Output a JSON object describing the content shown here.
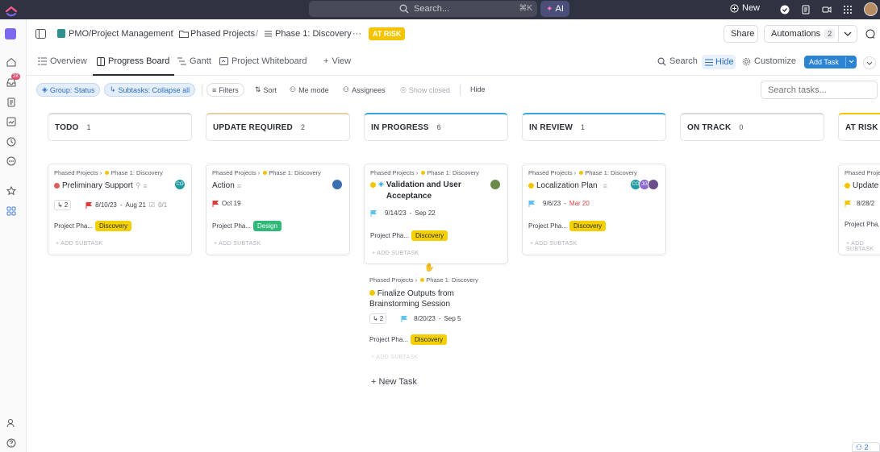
{
  "topbar": {
    "search_placeholder": "Search...",
    "search_shortcut": "⌘K",
    "ai_label": "AI",
    "new_label": "New"
  },
  "breadcrumb": {
    "space": "PMO/Project Management",
    "folder": "Phased Projects",
    "list": "Phase 1: Discovery",
    "more": "···",
    "status_badge": "AT RISK"
  },
  "header_actions": {
    "share": "Share",
    "automations": "Automations",
    "automations_count": "2"
  },
  "tabs": {
    "overview": "Overview",
    "progress_board": "Progress Board",
    "gantt": "Gantt",
    "whiteboard": "Project Whiteboard",
    "add_view": "View"
  },
  "view_actions": {
    "search": "Search",
    "hide": "Hide",
    "customize": "Customize",
    "add_task": "Add Task"
  },
  "filters": {
    "group": "Group: Status",
    "subtasks": "Subtasks: Collapse all",
    "filters": "Filters",
    "sort": "Sort",
    "me_mode": "Me mode",
    "assignees": "Assignees",
    "show_closed": "Show closed",
    "hide": "Hide",
    "search_placeholder": "Search tasks..."
  },
  "rail": {
    "notification_count": "28"
  },
  "colors": {
    "todo": "#d8d9de",
    "update": "#e6cfa2",
    "progress": "#3aa6d9",
    "review": "#3aa6d9",
    "ontrack": "#d8d9de",
    "atrisk": "#f5c400"
  },
  "columns": [
    {
      "name": "TODO",
      "count": "1"
    },
    {
      "name": "UPDATE REQUIRED",
      "count": "2"
    },
    {
      "name": "IN PROGRESS",
      "count": "6"
    },
    {
      "name": "IN REVIEW",
      "count": "1"
    },
    {
      "name": "ON TRACK",
      "count": "0"
    },
    {
      "name": "AT RISK",
      "count": ""
    }
  ],
  "common": {
    "path_folder": "Phased Projects",
    "path_list": "Phase 1: Discovery",
    "field_label": "Project Pha...",
    "add_subtask": "+ ADD SUBTASK",
    "tag_discovery": "Discovery",
    "tag_design": "Design"
  },
  "cards": {
    "todo_1": {
      "title": "Preliminary Support",
      "subtasks": "2",
      "start": "8/10/23",
      "due": "Aug 21",
      "checklist": "0/1",
      "assignee": "CO"
    },
    "update_1": {
      "title": "Action",
      "due": "Oct 19"
    },
    "progress_1": {
      "title": "Validation and User Acceptance",
      "start": "9/14/23",
      "due": "Sep 22"
    },
    "progress_2": {
      "title": "Finalize Outputs from Brainstorming Session",
      "subtasks": "2",
      "start": "8/20/23",
      "due": "Sep 5"
    },
    "review_1": {
      "title": "Localization Plan",
      "start": "9/6/23",
      "due": "Mar 20",
      "assignee_a": "CO",
      "assignee_b": "JG"
    },
    "atrisk_1": {
      "title": "Update",
      "start": "8/28/2"
    }
  },
  "new_task": "+ New Task",
  "presence_count": "2"
}
